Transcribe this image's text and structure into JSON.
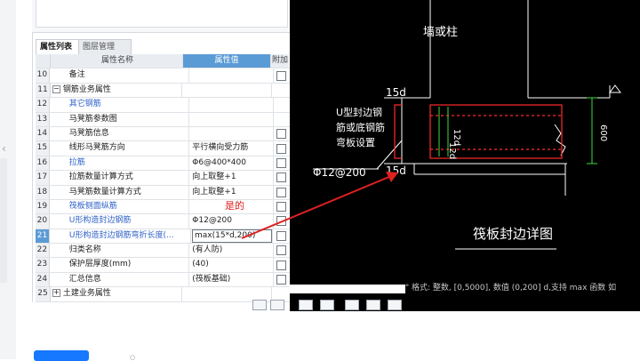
{
  "panel": {
    "tabs": [
      "属性列表",
      "图层管理"
    ],
    "headers": {
      "name": "属性名称",
      "value": "属性值",
      "add": "附加"
    }
  },
  "rows": [
    {
      "num": "10",
      "name": "备注",
      "value": "",
      "checkbox": true,
      "style": "plain"
    },
    {
      "num": "11",
      "name": "钢筋业务属性",
      "value": "",
      "checkbox": false,
      "style": "group",
      "expander": "−"
    },
    {
      "num": "12",
      "name": "其它钢筋",
      "value": "",
      "checkbox": false,
      "style": "link"
    },
    {
      "num": "13",
      "name": "马凳筋参数图",
      "value": "",
      "checkbox": false,
      "style": "indent"
    },
    {
      "num": "14",
      "name": "马凳筋信息",
      "value": "",
      "checkbox": true,
      "style": "indent"
    },
    {
      "num": "15",
      "name": "线形马凳筋方向",
      "value": "平行横向受力筋",
      "checkbox": true,
      "style": "indent"
    },
    {
      "num": "16",
      "name": "拉筋",
      "value": "Φ6@400*400",
      "checkbox": true,
      "style": "link"
    },
    {
      "num": "17",
      "name": "拉筋数量计算方式",
      "value": "向上取整+1",
      "checkbox": true,
      "style": "indent"
    },
    {
      "num": "18",
      "name": "马凳筋数量计算方式",
      "value": "向上取整+1",
      "checkbox": true,
      "style": "indent"
    },
    {
      "num": "19",
      "name": "筏板侧面纵筋",
      "value": "",
      "checkbox": true,
      "style": "link"
    },
    {
      "num": "20",
      "name": "U形构造封边钢筋",
      "value": "Φ12@200",
      "checkbox": true,
      "style": "link"
    },
    {
      "num": "21",
      "name": "U形构造封边钢筋弯折长度(...",
      "value": "max(15*d,200)",
      "checkbox": true,
      "style": "link",
      "selected": true
    },
    {
      "num": "22",
      "name": "归类名称",
      "value": "(有人防)",
      "checkbox": true,
      "style": "indent"
    },
    {
      "num": "23",
      "name": "保护层厚度(mm)",
      "value": "(40)",
      "checkbox": true,
      "style": "indent"
    },
    {
      "num": "24",
      "name": "汇总信息",
      "value": "(筏板基础)",
      "checkbox": true,
      "style": "indent"
    },
    {
      "num": "25",
      "name": "土建业务属性",
      "value": "",
      "checkbox": false,
      "style": "group",
      "expander": "+"
    }
  ],
  "annotation": "是的",
  "cad": {
    "labels": {
      "column": "墙或柱",
      "lap_top": "15d",
      "lap_bottom": "15d",
      "u_bar_line1": "U型封边钢",
      "u_bar_line2": "筋或底钢筋",
      "u_bar_line3": "弯板设置",
      "rebar": "Φ12@200",
      "dim_left": "12d",
      "dim_right": "12d",
      "height": "600",
      "title": "筏板封边详图"
    },
    "status_text": "\" 格式: 整数, [0,5000], 数值 (0,200] d,支持 max 函数 如"
  },
  "colors": {
    "accent": "#5b9bd5",
    "link": "#2f62c8",
    "annotation": "#e02020",
    "cad_red": "#ff2a2a",
    "cad_green": "#3ddc3d"
  }
}
